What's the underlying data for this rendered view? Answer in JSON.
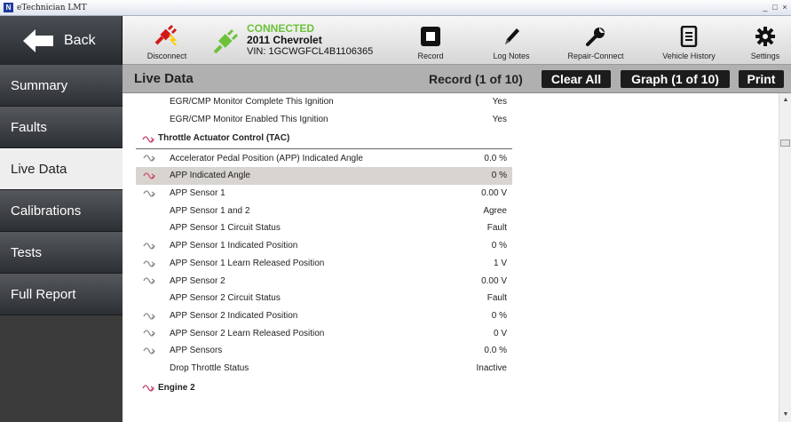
{
  "window": {
    "title": "eTechnician LMT",
    "logo": "N",
    "controls": [
      "_",
      "□",
      "×"
    ]
  },
  "toolbar": {
    "back_label": "Back",
    "disconnect_label": "Disconnect",
    "connection": {
      "status": "CONNECTED",
      "vehicle": "2011 Chevrolet",
      "vin": "VIN: 1GCWGFCL4B1106365"
    },
    "record_label": "Record",
    "log_notes_label": "Log Notes",
    "repair_connect_label": "Repair-Connect",
    "vehicle_history_label": "Vehicle History",
    "settings_label": "Settings"
  },
  "sidebar": {
    "items": [
      {
        "label": "Summary"
      },
      {
        "label": "Faults"
      },
      {
        "label": "Live Data"
      },
      {
        "label": "Calibrations"
      },
      {
        "label": "Tests"
      },
      {
        "label": "Full Report"
      }
    ]
  },
  "main": {
    "title": "Live Data",
    "record_status": "Record (1 of 10)",
    "clear_all_label": "Clear All",
    "graph_label": "Graph (1 of 10)",
    "print_label": "Print"
  },
  "rows": [
    {
      "label": "EGR/CMP Monitor Complete This Ignition",
      "value": "Yes",
      "icon": "none"
    },
    {
      "label": "EGR/CMP Monitor Enabled This Ignition",
      "value": "Yes",
      "icon": "none"
    },
    {
      "label": "Throttle Actuator Control (TAC)",
      "value": "",
      "icon": "section"
    },
    {
      "label": "Accelerator Pedal Position (APP) Indicated Angle",
      "value": "0.0 %",
      "icon": "graph"
    },
    {
      "label": "APP Indicated Angle",
      "value": "0 %",
      "icon": "graph-active",
      "selected": true
    },
    {
      "label": "APP Sensor 1",
      "value": "0.00 V",
      "icon": "graph"
    },
    {
      "label": "APP Sensor 1 and 2",
      "value": "Agree",
      "icon": "none"
    },
    {
      "label": "APP Sensor 1 Circuit Status",
      "value": "Fault",
      "icon": "none"
    },
    {
      "label": "APP Sensor 1 Indicated Position",
      "value": "0 %",
      "icon": "graph"
    },
    {
      "label": "APP Sensor 1 Learn Released Position",
      "value": "1 V",
      "icon": "graph"
    },
    {
      "label": "APP Sensor 2",
      "value": "0.00 V",
      "icon": "graph"
    },
    {
      "label": "APP Sensor 2 Circuit Status",
      "value": "Fault",
      "icon": "none"
    },
    {
      "label": "APP Sensor 2 Indicated Position",
      "value": "0 %",
      "icon": "graph"
    },
    {
      "label": "APP Sensor 2 Learn Released Position",
      "value": "0 V",
      "icon": "graph"
    },
    {
      "label": "APP Sensors",
      "value": "0.0 %",
      "icon": "graph"
    },
    {
      "label": "Drop Throttle Status",
      "value": "Inactive",
      "icon": "none"
    },
    {
      "label": "Engine 2",
      "value": "",
      "icon": "section2"
    }
  ],
  "colors": {
    "connected": "#6cc23a",
    "graph_icon": "#888888",
    "graph_icon_active": "#d04a6a",
    "section_icon": "#c43a6a"
  }
}
